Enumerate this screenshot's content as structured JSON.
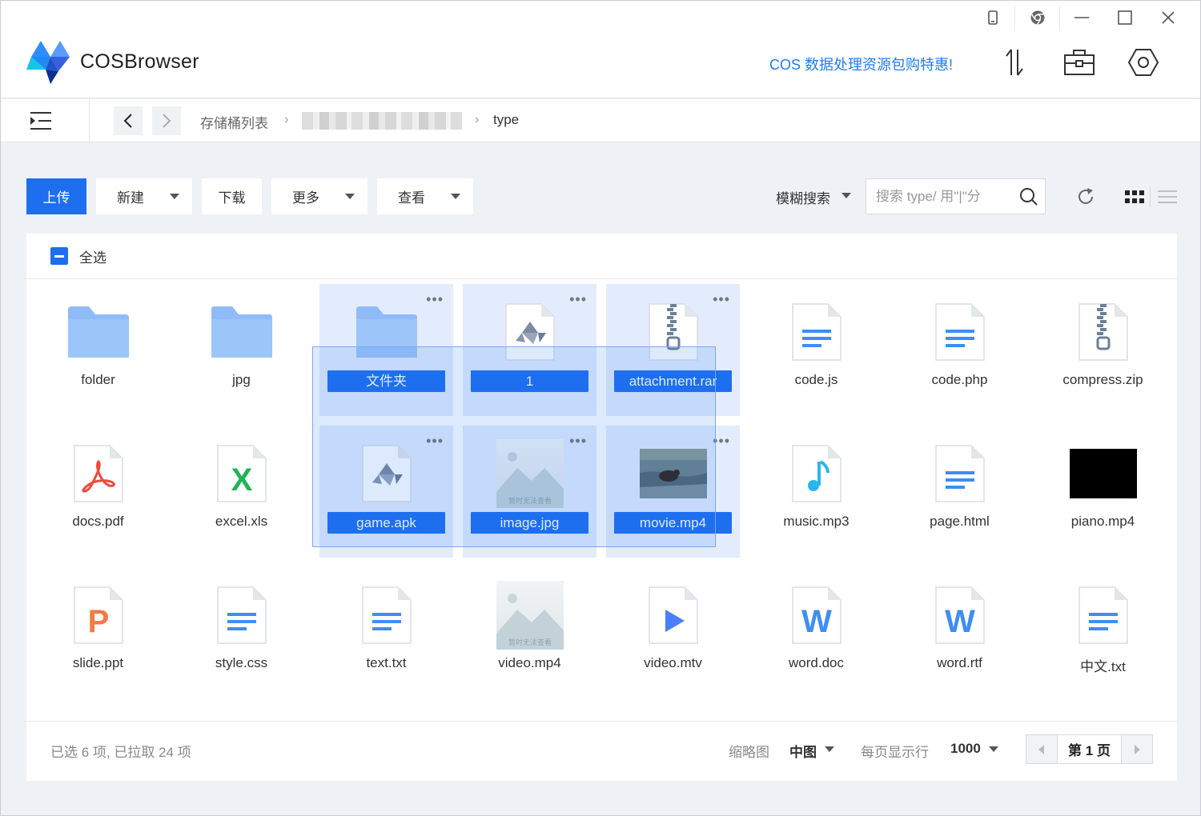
{
  "app": {
    "name": "COSBrowser",
    "promo": "COS 数据处理资源包购特惠!"
  },
  "window_controls": [
    "phone-icon",
    "chrome-icon",
    "minimize-icon",
    "maximize-icon",
    "close-icon"
  ],
  "header_tools": [
    "transfer-icon",
    "toolbox-icon",
    "settings-icon"
  ],
  "breadcrumb": {
    "root": "存储桶列表",
    "current": "type"
  },
  "toolbar": {
    "upload": "上传",
    "new": "新建",
    "download": "下载",
    "more": "更多",
    "view": "查看",
    "search_mode": "模糊搜索",
    "search_placeholder": "搜索 type/ 用\"|\"分"
  },
  "select_all": "全选",
  "files": [
    {
      "name": "folder",
      "icon": "folder",
      "selected": false
    },
    {
      "name": "jpg",
      "icon": "folder",
      "selected": false
    },
    {
      "name": "文件夹",
      "icon": "folder",
      "selected": true
    },
    {
      "name": "1",
      "icon": "apk",
      "selected": true
    },
    {
      "name": "attachment.rar",
      "icon": "zip",
      "selected": true
    },
    {
      "name": "code.js",
      "icon": "doc-lines",
      "selected": false
    },
    {
      "name": "code.php",
      "icon": "doc-lines",
      "selected": false
    },
    {
      "name": "compress.zip",
      "icon": "zip",
      "selected": false
    },
    {
      "name": "docs.pdf",
      "icon": "pdf",
      "selected": false
    },
    {
      "name": "excel.xls",
      "icon": "excel",
      "selected": false
    },
    {
      "name": "game.apk",
      "icon": "apk",
      "selected": true
    },
    {
      "name": "image.jpg",
      "icon": "image-placeholder",
      "selected": true
    },
    {
      "name": "movie.mp4",
      "icon": "video-thumb",
      "selected": true
    },
    {
      "name": "music.mp3",
      "icon": "music",
      "selected": false
    },
    {
      "name": "page.html",
      "icon": "doc-lines",
      "selected": false
    },
    {
      "name": "piano.mp4",
      "icon": "black-thumb",
      "selected": false
    },
    {
      "name": "slide.ppt",
      "icon": "ppt",
      "selected": false
    },
    {
      "name": "style.css",
      "icon": "doc-lines",
      "selected": false
    },
    {
      "name": "text.txt",
      "icon": "doc-lines",
      "selected": false
    },
    {
      "name": "video.mp4",
      "icon": "image-placeholder",
      "selected": false
    },
    {
      "name": "video.mtv",
      "icon": "video-play",
      "selected": false
    },
    {
      "name": "word.doc",
      "icon": "word",
      "selected": false
    },
    {
      "name": "word.rtf",
      "icon": "word",
      "selected": false
    },
    {
      "name": "中文.txt",
      "icon": "doc-lines",
      "selected": false
    }
  ],
  "placeholder_text": "暂时无法查看",
  "footer": {
    "status": "已选 6 项, 已拉取 24 项",
    "thumb_label": "缩略图",
    "thumb_value": "中图",
    "per_page_label": "每页显示行",
    "per_page_value": "1000",
    "page": "第 1 页"
  },
  "colors": {
    "accent": "#1e6ff0",
    "folder": "#8fbcf8",
    "selection": "#e2ecfd"
  }
}
